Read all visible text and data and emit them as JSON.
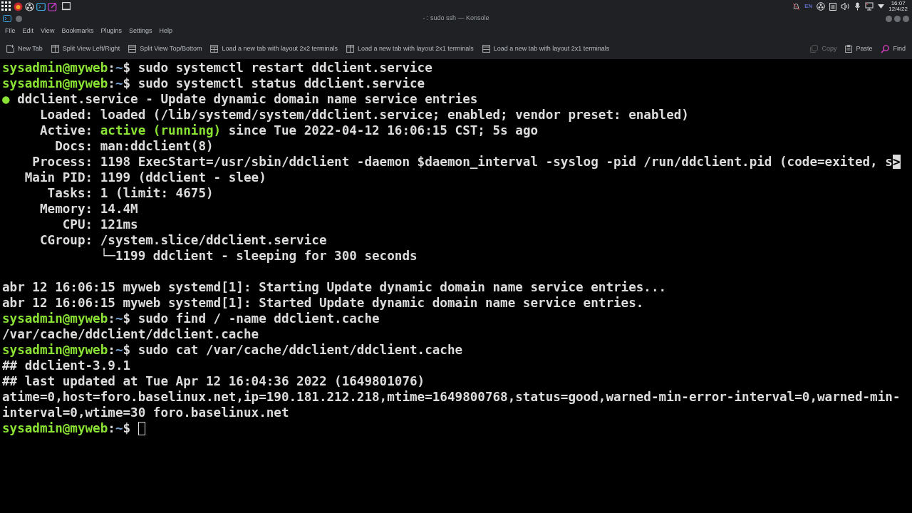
{
  "panel": {
    "language": "EN",
    "clock": {
      "time": "16:07",
      "date": "12/4/22"
    }
  },
  "window": {
    "title": "- : sudo ssh — Konsole"
  },
  "menu": [
    "File",
    "Edit",
    "View",
    "Bookmarks",
    "Plugins",
    "Settings",
    "Help"
  ],
  "toolbar": [
    {
      "label": "New Tab",
      "kind": "newtab",
      "disabled": false
    },
    {
      "label": "Split View Left/Right",
      "kind": "splitlr",
      "disabled": false
    },
    {
      "label": "Split View Top/Bottom",
      "kind": "splittb",
      "disabled": false
    },
    {
      "label": "Load a new tab with layout 2x2 terminals",
      "kind": "grid",
      "disabled": false
    },
    {
      "label": "Load a new tab with layout 2x1 terminals",
      "kind": "splitlr",
      "disabled": false
    },
    {
      "label": "Load a new tab with layout 2x1 terminals",
      "kind": "splittb",
      "disabled": false
    }
  ],
  "toolbar_right": [
    {
      "label": "Copy",
      "kind": "copy",
      "disabled": true
    },
    {
      "label": "Paste",
      "kind": "paste",
      "disabled": false
    },
    {
      "label": "Find",
      "kind": "find",
      "disabled": false
    }
  ],
  "terminal": {
    "lines": [
      {
        "segments": [
          {
            "kind": "user",
            "text": "sysadmin@myweb"
          },
          {
            "kind": "plain",
            "text": ":"
          },
          {
            "kind": "path",
            "text": "~"
          },
          {
            "kind": "plain",
            "text": "$ sudo systemctl restart ddclient.service"
          }
        ]
      },
      {
        "segments": [
          {
            "kind": "user",
            "text": "sysadmin@myweb"
          },
          {
            "kind": "plain",
            "text": ":"
          },
          {
            "kind": "path",
            "text": "~"
          },
          {
            "kind": "plain",
            "text": "$ sudo systemctl status ddclient.service"
          }
        ]
      },
      {
        "segments": [
          {
            "kind": "ok",
            "text": "●"
          },
          {
            "kind": "plain",
            "text": " ddclient.service - Update dynamic domain name service entries"
          }
        ]
      },
      {
        "segments": [
          {
            "kind": "plain",
            "text": "     Loaded: loaded (/lib/systemd/system/ddclient.service; enabled; vendor preset: enabled)"
          }
        ]
      },
      {
        "segments": [
          {
            "kind": "plain",
            "text": "     Active: "
          },
          {
            "kind": "ok",
            "text": "active (running)"
          },
          {
            "kind": "plain",
            "text": " since Tue 2022-04-12 16:06:15 CST; 5s ago"
          }
        ]
      },
      {
        "segments": [
          {
            "kind": "plain",
            "text": "       Docs: man:ddclient(8)"
          }
        ]
      },
      {
        "segments": [
          {
            "kind": "plain",
            "text": "    Process: 1198 ExecStart=/usr/sbin/ddclient -daemon $daemon_interval -syslog -pid /run/ddclient.pid (code=exited, s"
          },
          {
            "kind": "marker",
            "text": ">"
          }
        ]
      },
      {
        "segments": [
          {
            "kind": "plain",
            "text": "   Main PID: 1199 (ddclient - slee)"
          }
        ]
      },
      {
        "segments": [
          {
            "kind": "plain",
            "text": "      Tasks: 1 (limit: 4675)"
          }
        ]
      },
      {
        "segments": [
          {
            "kind": "plain",
            "text": "     Memory: 14.4M"
          }
        ]
      },
      {
        "segments": [
          {
            "kind": "plain",
            "text": "        CPU: 121ms"
          }
        ]
      },
      {
        "segments": [
          {
            "kind": "plain",
            "text": "     CGroup: /system.slice/ddclient.service"
          }
        ]
      },
      {
        "segments": [
          {
            "kind": "plain",
            "text": "             └─1199 ddclient - sleeping for 300 seconds"
          }
        ]
      },
      {
        "blank_before": true,
        "segments": [
          {
            "kind": "plain",
            "text": "abr 12 16:06:15 myweb systemd[1]: Starting Update dynamic domain name service entries..."
          }
        ]
      },
      {
        "segments": [
          {
            "kind": "plain",
            "text": "abr 12 16:06:15 myweb systemd[1]: Started Update dynamic domain name service entries."
          }
        ]
      },
      {
        "segments": [
          {
            "kind": "user",
            "text": "sysadmin@myweb"
          },
          {
            "kind": "plain",
            "text": ":"
          },
          {
            "kind": "path",
            "text": "~"
          },
          {
            "kind": "plain",
            "text": "$ sudo find / -name ddclient.cache"
          }
        ]
      },
      {
        "segments": [
          {
            "kind": "plain",
            "text": "/var/cache/ddclient/ddclient.cache"
          }
        ]
      },
      {
        "segments": [
          {
            "kind": "user",
            "text": "sysadmin@myweb"
          },
          {
            "kind": "plain",
            "text": ":"
          },
          {
            "kind": "path",
            "text": "~"
          },
          {
            "kind": "plain",
            "text": "$ sudo cat /var/cache/ddclient/ddclient.cache"
          }
        ]
      },
      {
        "segments": [
          {
            "kind": "plain",
            "text": "## ddclient-3.9.1"
          }
        ]
      },
      {
        "segments": [
          {
            "kind": "plain",
            "text": "## last updated at Tue Apr 12 16:04:36 2022 (1649801076)"
          }
        ]
      },
      {
        "segments": [
          {
            "kind": "plain",
            "text": "atime=0,host=foro.baselinux.net,ip=190.181.212.218,mtime=1649800768,status=good,warned-min-error-interval=0,warned-min-"
          }
        ]
      },
      {
        "segments": [
          {
            "kind": "plain",
            "text": "interval=0,wtime=30 foro.baselinux.net"
          }
        ]
      },
      {
        "segments": [
          {
            "kind": "user",
            "text": "sysadmin@myweb"
          },
          {
            "kind": "plain",
            "text": ":"
          },
          {
            "kind": "path",
            "text": "~"
          },
          {
            "kind": "plain",
            "text": "$ "
          }
        ],
        "cursor": true
      }
    ]
  }
}
